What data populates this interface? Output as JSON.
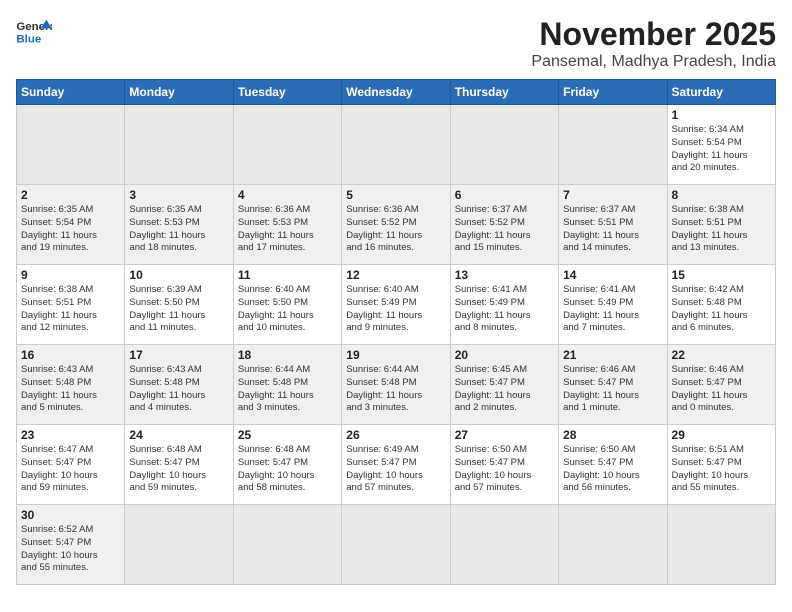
{
  "header": {
    "logo_general": "General",
    "logo_blue": "Blue",
    "month": "November 2025",
    "location": "Pansemal, Madhya Pradesh, India"
  },
  "weekdays": [
    "Sunday",
    "Monday",
    "Tuesday",
    "Wednesday",
    "Thursday",
    "Friday",
    "Saturday"
  ],
  "weeks": [
    [
      {
        "day": "",
        "info": ""
      },
      {
        "day": "",
        "info": ""
      },
      {
        "day": "",
        "info": ""
      },
      {
        "day": "",
        "info": ""
      },
      {
        "day": "",
        "info": ""
      },
      {
        "day": "",
        "info": ""
      },
      {
        "day": "1",
        "info": "Sunrise: 6:34 AM\nSunset: 5:54 PM\nDaylight: 11 hours\nand 20 minutes."
      }
    ],
    [
      {
        "day": "2",
        "info": "Sunrise: 6:35 AM\nSunset: 5:54 PM\nDaylight: 11 hours\nand 19 minutes."
      },
      {
        "day": "3",
        "info": "Sunrise: 6:35 AM\nSunset: 5:53 PM\nDaylight: 11 hours\nand 18 minutes."
      },
      {
        "day": "4",
        "info": "Sunrise: 6:36 AM\nSunset: 5:53 PM\nDaylight: 11 hours\nand 17 minutes."
      },
      {
        "day": "5",
        "info": "Sunrise: 6:36 AM\nSunset: 5:52 PM\nDaylight: 11 hours\nand 16 minutes."
      },
      {
        "day": "6",
        "info": "Sunrise: 6:37 AM\nSunset: 5:52 PM\nDaylight: 11 hours\nand 15 minutes."
      },
      {
        "day": "7",
        "info": "Sunrise: 6:37 AM\nSunset: 5:51 PM\nDaylight: 11 hours\nand 14 minutes."
      },
      {
        "day": "8",
        "info": "Sunrise: 6:38 AM\nSunset: 5:51 PM\nDaylight: 11 hours\nand 13 minutes."
      }
    ],
    [
      {
        "day": "9",
        "info": "Sunrise: 6:38 AM\nSunset: 5:51 PM\nDaylight: 11 hours\nand 12 minutes."
      },
      {
        "day": "10",
        "info": "Sunrise: 6:39 AM\nSunset: 5:50 PM\nDaylight: 11 hours\nand 11 minutes."
      },
      {
        "day": "11",
        "info": "Sunrise: 6:40 AM\nSunset: 5:50 PM\nDaylight: 11 hours\nand 10 minutes."
      },
      {
        "day": "12",
        "info": "Sunrise: 6:40 AM\nSunset: 5:49 PM\nDaylight: 11 hours\nand 9 minutes."
      },
      {
        "day": "13",
        "info": "Sunrise: 6:41 AM\nSunset: 5:49 PM\nDaylight: 11 hours\nand 8 minutes."
      },
      {
        "day": "14",
        "info": "Sunrise: 6:41 AM\nSunset: 5:49 PM\nDaylight: 11 hours\nand 7 minutes."
      },
      {
        "day": "15",
        "info": "Sunrise: 6:42 AM\nSunset: 5:48 PM\nDaylight: 11 hours\nand 6 minutes."
      }
    ],
    [
      {
        "day": "16",
        "info": "Sunrise: 6:43 AM\nSunset: 5:48 PM\nDaylight: 11 hours\nand 5 minutes."
      },
      {
        "day": "17",
        "info": "Sunrise: 6:43 AM\nSunset: 5:48 PM\nDaylight: 11 hours\nand 4 minutes."
      },
      {
        "day": "18",
        "info": "Sunrise: 6:44 AM\nSunset: 5:48 PM\nDaylight: 11 hours\nand 3 minutes."
      },
      {
        "day": "19",
        "info": "Sunrise: 6:44 AM\nSunset: 5:48 PM\nDaylight: 11 hours\nand 3 minutes."
      },
      {
        "day": "20",
        "info": "Sunrise: 6:45 AM\nSunset: 5:47 PM\nDaylight: 11 hours\nand 2 minutes."
      },
      {
        "day": "21",
        "info": "Sunrise: 6:46 AM\nSunset: 5:47 PM\nDaylight: 11 hours\nand 1 minute."
      },
      {
        "day": "22",
        "info": "Sunrise: 6:46 AM\nSunset: 5:47 PM\nDaylight: 11 hours\nand 0 minutes."
      }
    ],
    [
      {
        "day": "23",
        "info": "Sunrise: 6:47 AM\nSunset: 5:47 PM\nDaylight: 10 hours\nand 59 minutes."
      },
      {
        "day": "24",
        "info": "Sunrise: 6:48 AM\nSunset: 5:47 PM\nDaylight: 10 hours\nand 59 minutes."
      },
      {
        "day": "25",
        "info": "Sunrise: 6:48 AM\nSunset: 5:47 PM\nDaylight: 10 hours\nand 58 minutes."
      },
      {
        "day": "26",
        "info": "Sunrise: 6:49 AM\nSunset: 5:47 PM\nDaylight: 10 hours\nand 57 minutes."
      },
      {
        "day": "27",
        "info": "Sunrise: 6:50 AM\nSunset: 5:47 PM\nDaylight: 10 hours\nand 57 minutes."
      },
      {
        "day": "28",
        "info": "Sunrise: 6:50 AM\nSunset: 5:47 PM\nDaylight: 10 hours\nand 56 minutes."
      },
      {
        "day": "29",
        "info": "Sunrise: 6:51 AM\nSunset: 5:47 PM\nDaylight: 10 hours\nand 55 minutes."
      }
    ],
    [
      {
        "day": "30",
        "info": "Sunrise: 6:52 AM\nSunset: 5:47 PM\nDaylight: 10 hours\nand 55 minutes."
      },
      {
        "day": "",
        "info": ""
      },
      {
        "day": "",
        "info": ""
      },
      {
        "day": "",
        "info": ""
      },
      {
        "day": "",
        "info": ""
      },
      {
        "day": "",
        "info": ""
      },
      {
        "day": "",
        "info": ""
      }
    ]
  ]
}
